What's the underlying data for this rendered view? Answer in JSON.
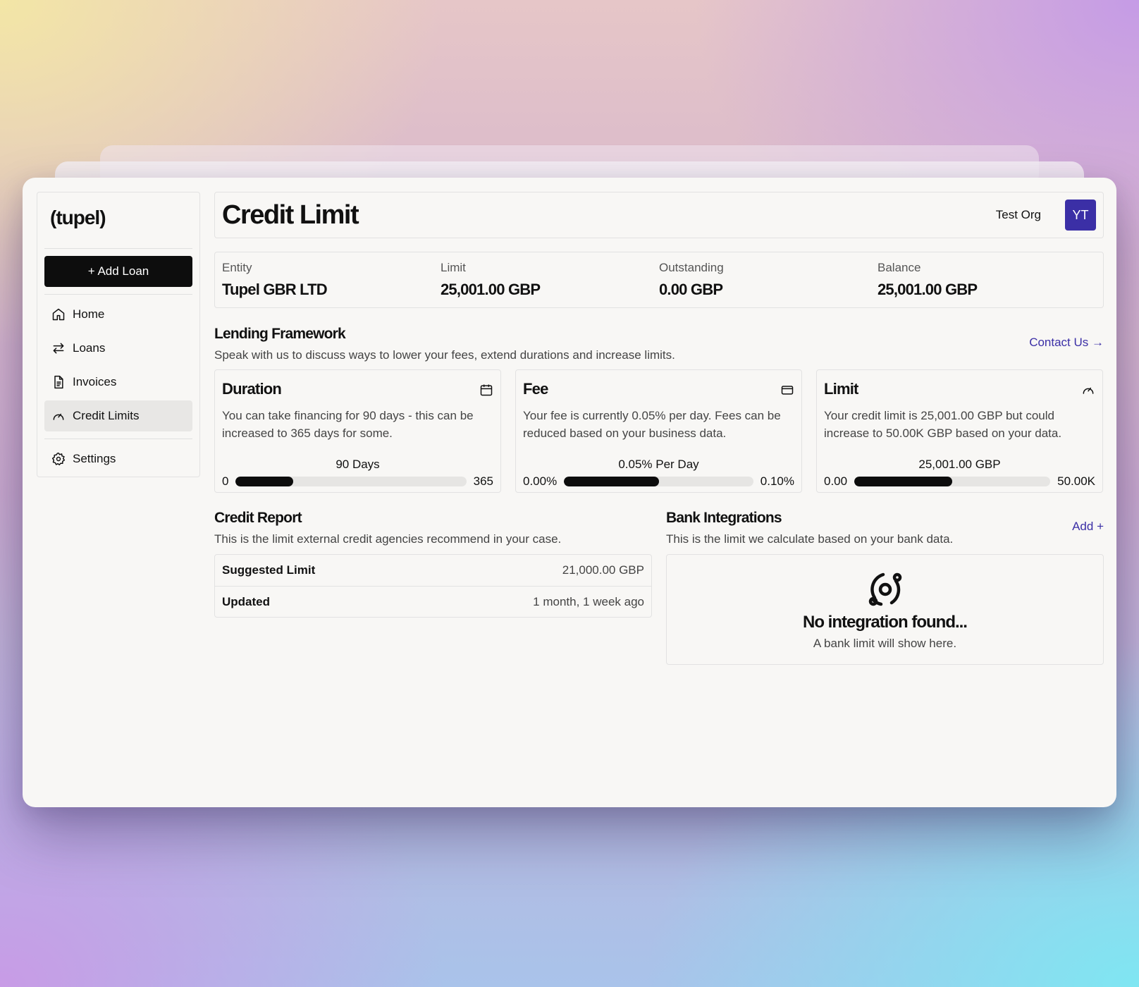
{
  "sidebar": {
    "logo": "(tupel)",
    "add_loan": "+ Add Loan",
    "items": [
      {
        "label": "Home"
      },
      {
        "label": "Loans"
      },
      {
        "label": "Invoices"
      },
      {
        "label": "Credit Limits"
      }
    ],
    "settings": "Settings"
  },
  "header": {
    "title": "Credit Limit",
    "org": "Test Org",
    "avatar": "YT"
  },
  "stats": [
    {
      "label": "Entity",
      "value": "Tupel GBR LTD"
    },
    {
      "label": "Limit",
      "value": "25,001.00 GBP"
    },
    {
      "label": "Outstanding",
      "value": "0.00 GBP"
    },
    {
      "label": "Balance",
      "value": "25,001.00 GBP"
    }
  ],
  "framework": {
    "title": "Lending Framework",
    "subtitle": "Speak with us to discuss ways to lower your fees, extend durations and increase limits.",
    "link": "Contact Us →",
    "cards": [
      {
        "title": "Duration",
        "desc": "You can take financing for 90 days - this can be increased to 365 days for some.",
        "bar_label": "90 Days",
        "min": "0",
        "max": "365",
        "fill_pct": 25
      },
      {
        "title": "Fee",
        "desc": "Your fee is currently 0.05% per day. Fees can be reduced based on your business data.",
        "bar_label": "0.05% Per Day",
        "min": "0.00%",
        "max": "0.10%",
        "fill_pct": 50
      },
      {
        "title": "Limit",
        "desc": "Your credit limit is 25,001.00 GBP but could increase to 50.00K GBP based on your data.",
        "bar_label": "25,001.00 GBP",
        "min": "0.00",
        "max": "50.00K",
        "fill_pct": 50
      }
    ]
  },
  "credit_report": {
    "title": "Credit Report",
    "subtitle": "This is the limit external credit agencies recommend in your case.",
    "rows": [
      {
        "key": "Suggested Limit",
        "value": "21,000.00 GBP"
      },
      {
        "key": "Updated",
        "value": "1 month, 1 week ago"
      }
    ]
  },
  "bank": {
    "title": "Bank Integrations",
    "subtitle": "This is the limit we calculate based on your bank data.",
    "link": "Add +",
    "empty_title": "No integration found...",
    "empty_sub": "A bank limit will show here."
  },
  "colors": {
    "accent": "#3b2fa6",
    "bar_fill": "#0d0d0d",
    "bar_track": "#e6e5e3"
  }
}
